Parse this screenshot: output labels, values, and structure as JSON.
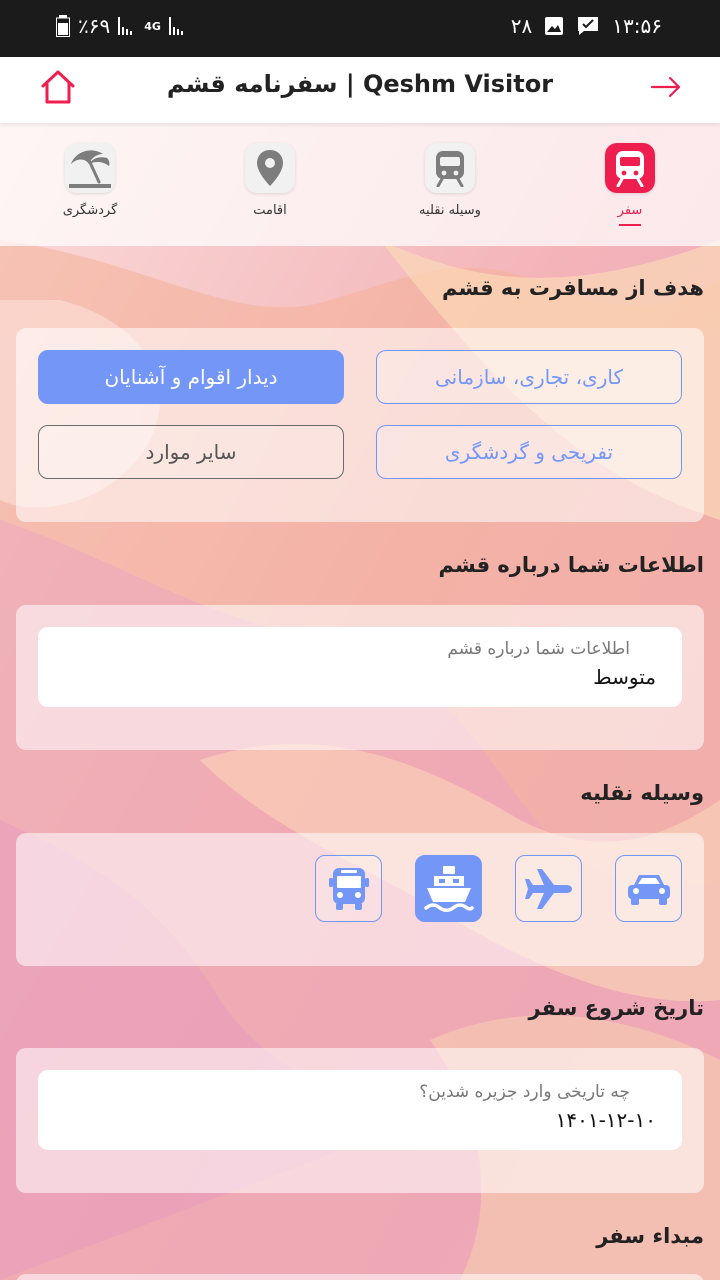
{
  "status_bar": {
    "battery": "٪۶۹",
    "network": "4G",
    "day": "۲۸",
    "time": "۱۳:۵۶"
  },
  "header": {
    "title": "سفرنامه قشم | Qeshm Visitor"
  },
  "tabs": [
    {
      "label": "سفر",
      "icon": "train-icon",
      "active": true
    },
    {
      "label": "وسیله نقلیه",
      "icon": "train-icon",
      "active": false
    },
    {
      "label": "اقامت",
      "icon": "location-pin-icon",
      "active": false
    },
    {
      "label": "گردشگری",
      "icon": "beach-umbrella-icon",
      "active": false
    }
  ],
  "purpose": {
    "title": "هدف از مسافرت به قشم",
    "options": [
      {
        "label": "کاری، تجاری، سازمانی",
        "selected": false
      },
      {
        "label": "دیدار اقوام و آشنایان",
        "selected": true
      },
      {
        "label": "تفریحی و گردشگری",
        "selected": false
      },
      {
        "label": "سایر موارد",
        "selected": false
      }
    ]
  },
  "knowledge": {
    "title": "اطلاعات شما درباره قشم",
    "field_label": "اطلاعات شما درباره قشم",
    "field_value": "متوسط"
  },
  "vehicle": {
    "title": "وسیله نقلیه",
    "options": [
      {
        "icon": "car-icon",
        "selected": false
      },
      {
        "icon": "airplane-icon",
        "selected": false
      },
      {
        "icon": "ship-icon",
        "selected": true
      },
      {
        "icon": "bus-icon",
        "selected": false
      }
    ]
  },
  "start_date": {
    "title": "تاریخ شروع سفر",
    "field_label": "چه تاریخی وارد جزیره شدین؟",
    "field_value": "۱۴۰۱-۱۲-۱۰"
  },
  "origin": {
    "title": "مبداء سفر"
  },
  "colors": {
    "accent_red": "#ee1e4f",
    "accent_blue": "#7396f7"
  }
}
